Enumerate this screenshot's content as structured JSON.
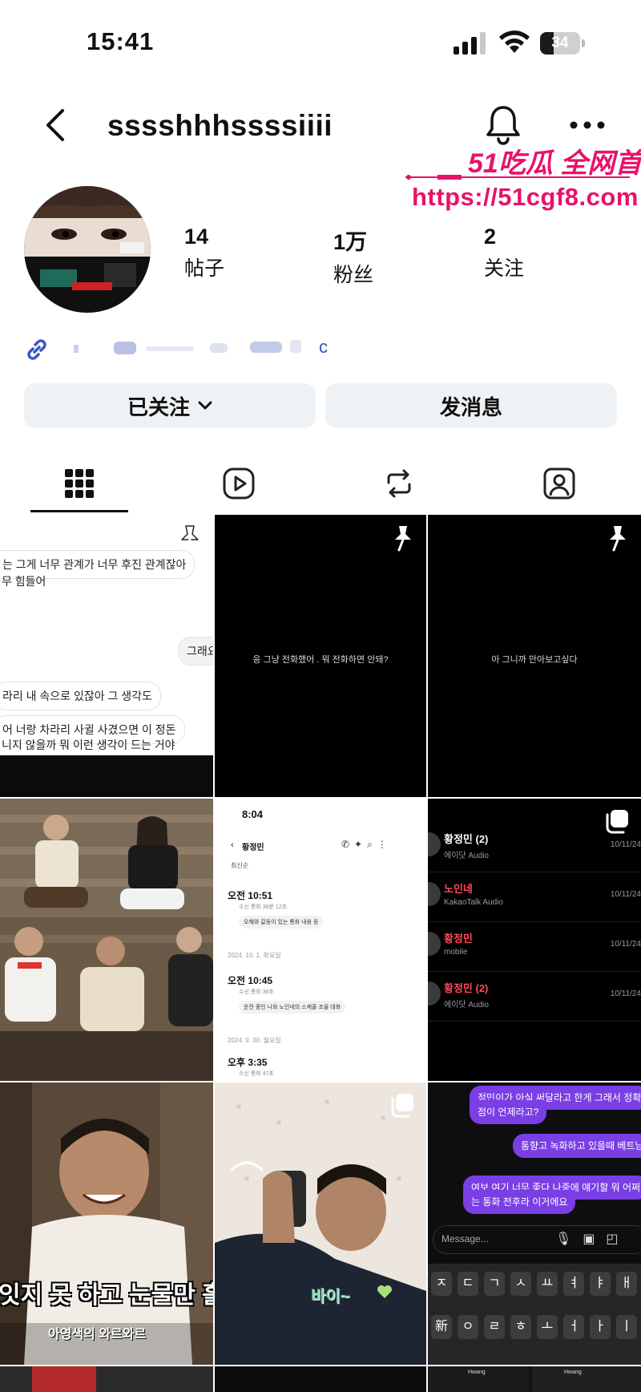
{
  "status_bar": {
    "time": "15:41",
    "battery": "34",
    "battery_level": 0.34
  },
  "header": {
    "username": "sssshhhssssiiii"
  },
  "watermark": {
    "brand": "51吃瓜 全网首发",
    "url": "https://51cgf8.com",
    "color": "#e8126a"
  },
  "profile": {
    "stats": [
      {
        "value": "14",
        "label": "帖子"
      },
      {
        "value": "1万",
        "label": "粉丝"
      },
      {
        "value": "2",
        "label": "关注"
      }
    ],
    "link_tail": "c"
  },
  "actions": {
    "follow_label": "已关注",
    "message_label": "发消息"
  },
  "tabs": [
    {
      "name": "posts",
      "icon": "grid-icon",
      "active": true
    },
    {
      "name": "reels",
      "icon": "reels-icon",
      "active": false
    },
    {
      "name": "reposts",
      "icon": "repost-icon",
      "active": false
    },
    {
      "name": "tagged",
      "icon": "tagged-icon",
      "active": false
    }
  ],
  "posts": {
    "p1": {
      "lines": [
        "는 그게 너무 관계가 너무 후진 관계잖아",
        "무 힘들어",
        "그래요",
        "라리 내 속으로 있잖아 그 생각도",
        "어 너랑 차라리 사귈 사겼으면 이 정돈",
        "니지 않을까 뭐 이런 생각이 드는 거야"
      ]
    },
    "p2": {
      "caption": "응 그냥 전화했어 . 뭐 전화하면 안돼?"
    },
    "p3": {
      "caption": "아 그니까 만아보고싶다"
    },
    "p5": {
      "time": "8:04",
      "contact": "황정민",
      "filter": "최신순",
      "entries": [
        {
          "time": "오전 10:51",
          "sub": "수신 통화 38분 12초",
          "summary": "오해와 갈등이 있는 통화 내용 등"
        },
        {
          "date": "2024. 10. 1. 화요일"
        },
        {
          "time": "오전 10:45",
          "sub": "수신 통화 36초",
          "summary": "운전 중인 나와 노인네의 스케줄 조율 대화"
        },
        {
          "date": "2024. 9. 30. 월요일"
        },
        {
          "time": "오후 3:35",
          "sub": "수신 통화 47초"
        }
      ]
    },
    "p6": {
      "rows": [
        {
          "name": "황정민 (2)",
          "sub": "에이닷 Audio",
          "date": "10/11/24",
          "color": "#ffffff"
        },
        {
          "name": "노인네",
          "sub": "KakaoTalk Audio",
          "date": "10/11/24",
          "color": "#ff4a5a"
        },
        {
          "name": "황정민",
          "sub": "mobile",
          "date": "10/11/24",
          "color": "#ff4a5a"
        },
        {
          "name": "황정민 (2)",
          "sub": "에이닷 Audio",
          "date": "10/11/24",
          "color": "#ff4a5a"
        }
      ]
    },
    "p7": {
      "subtitle": "잇지 못 하고 눈물만 흘린",
      "caption": "아영색의 와르와르"
    },
    "p8": {
      "caption": "바이~"
    },
    "p9": {
      "bubbles": [
        "정민이가 아실 써달라고 한게 그래서 정확",
        "점이 언제라고?",
        "통향고 녹화하고 있을때 베트남",
        "여보 여기 너무 좋다 나중에 얘기할 뭐 어쩌",
        "는 통화 전후라 이거에요"
      ],
      "input_placeholder": "Message...",
      "keys_row1": [
        "ㅈ",
        "ㄷ",
        "ㄱ",
        "ㅅ",
        "ㅛ",
        "ㅕ",
        "ㅑ",
        "ㅐ"
      ],
      "keys_row2": [
        "新",
        "ㅇ",
        "ㄹ",
        "ㅎ",
        "ㅗ",
        "ㅓ",
        "ㅏ",
        "ㅣ"
      ],
      "purple": "#7a3fe4"
    },
    "p12": {
      "label": "Hwang"
    },
    "p11": {
      "label": "Hwang"
    }
  }
}
